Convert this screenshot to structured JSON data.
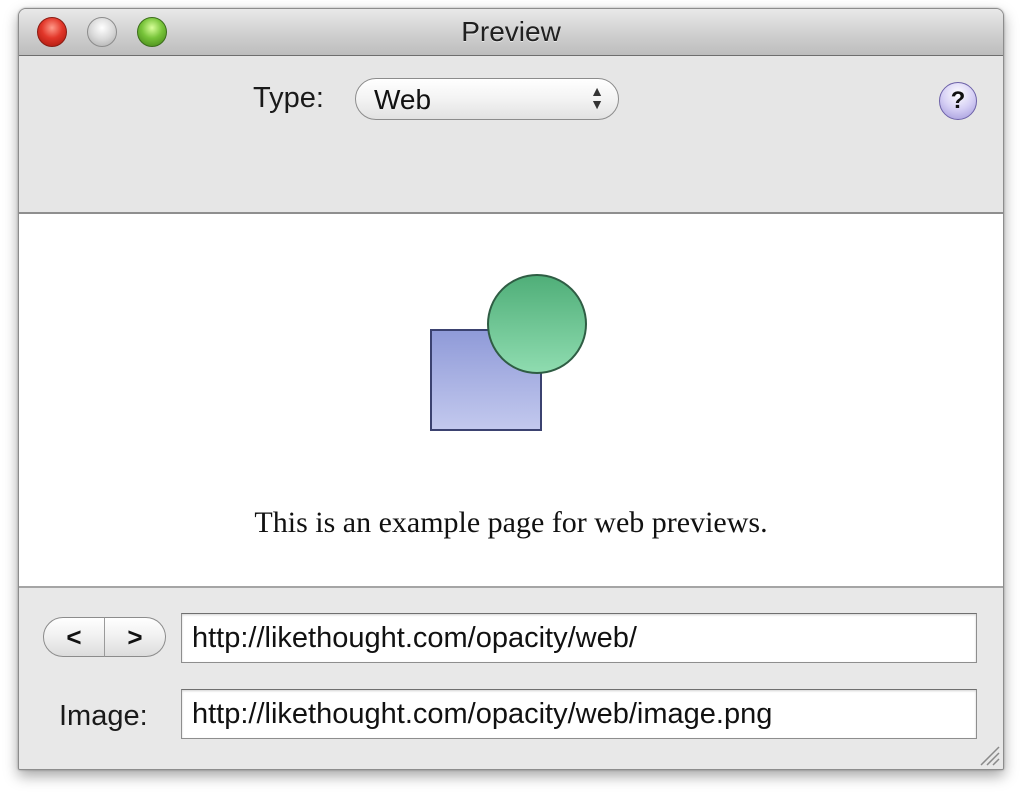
{
  "window": {
    "title": "Preview"
  },
  "toolbar": {
    "type_label": "Type:",
    "type_select": {
      "selected": "Web",
      "arrows_icon": "up-down-arrows-icon"
    },
    "help_button": "?"
  },
  "preview": {
    "text": "This is an example page for web previews.",
    "graphic": {
      "square_color": "#a9b2e3",
      "circle_color": "#6cc596"
    }
  },
  "bottom": {
    "back_label": "<",
    "forward_label": ">",
    "page_url": "http://likethought.com/opacity/web/",
    "image_label": "Image:",
    "image_url": "http://likethought.com/opacity/web/image.png"
  },
  "colors": {
    "close": "#e2372a",
    "minimize": "#bdbdbd",
    "zoom": "#78c43a",
    "help": "#d6d0f5"
  }
}
